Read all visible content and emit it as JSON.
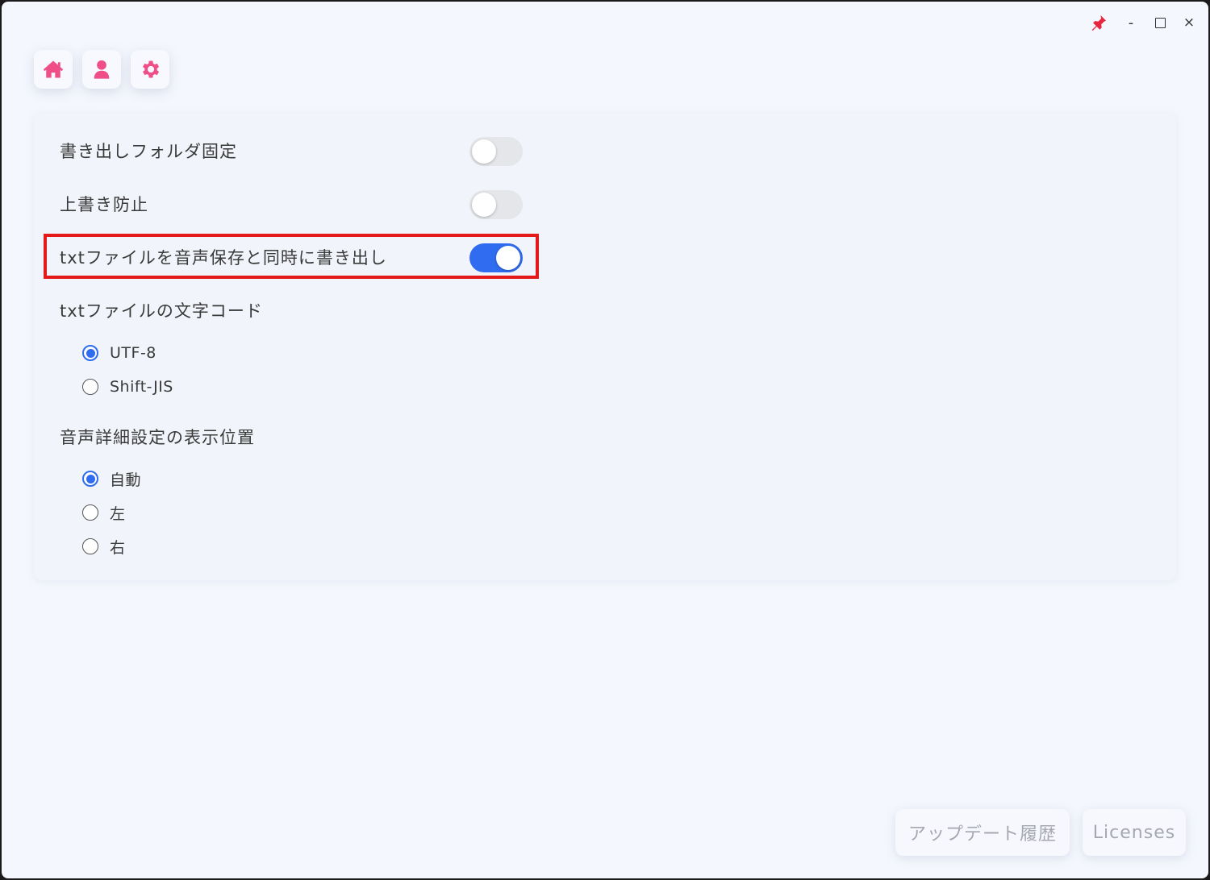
{
  "titlebar": {
    "pin_icon": "pin-icon",
    "minimize_label": "-",
    "close_label": "×"
  },
  "nav": {
    "items": [
      {
        "icon": "home-icon",
        "color": "#ef4f86"
      },
      {
        "icon": "user-icon",
        "color": "#ef4f86"
      },
      {
        "icon": "gear-icon",
        "color": "#ef4f86"
      }
    ]
  },
  "settings": {
    "fixed_output_folder": {
      "label": "書き出しフォルダ固定",
      "enabled": false
    },
    "prevent_overwrite": {
      "label": "上書き防止",
      "enabled": false
    },
    "export_txt_with_audio": {
      "label": "txtファイルを音声保存と同時に書き出し",
      "enabled": true
    },
    "txt_encoding": {
      "label": "txtファイルの文字コード",
      "options": [
        "UTF-8",
        "Shift-JIS"
      ],
      "selected": "UTF-8"
    },
    "detail_position": {
      "label": "音声詳細設定の表示位置",
      "options": [
        "自動",
        "左",
        "右"
      ],
      "selected": "自動"
    }
  },
  "footer": {
    "history_label": "アップデート履歴",
    "licenses_label": "Licenses"
  },
  "colors": {
    "accent": "#2f6cf0",
    "nav_icon": "#ef4f86",
    "highlight": "#e41a1a",
    "background": "#f4f7fd"
  }
}
